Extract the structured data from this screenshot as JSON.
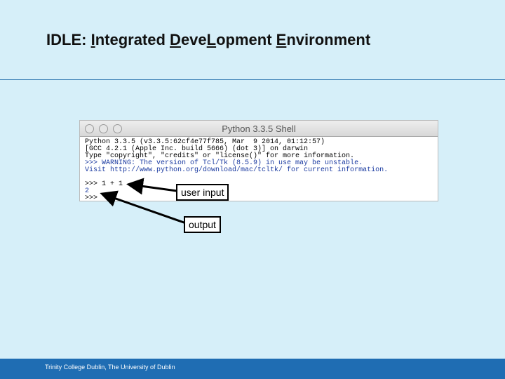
{
  "slide": {
    "title_parts": [
      "IDLE: ",
      "I",
      "ntegrated ",
      "D",
      "eve",
      "L",
      "opment ",
      "E",
      "nvironment"
    ],
    "footer": "Trinity College Dublin, The University of Dublin"
  },
  "shell": {
    "window_title": "Python 3.3.5 Shell",
    "lines": [
      "Python 3.3.5 (v3.3.5:62cf4e77f785, Mar  9 2014, 01:12:57)",
      "[GCC 4.2.1 (Apple Inc. build 5666) (dot 3)] on darwin",
      "Type \"copyright\", \"credits\" or \"license()\" for more information.",
      ">>> WARNING: The version of Tcl/Tk (8.5.9) in use may be unstable.",
      "Visit http://www.python.org/download/mac/tcltk/ for current information.",
      "",
      ">>> 1 + 1",
      "2",
      ">>> "
    ]
  },
  "annotations": {
    "user_input": "user input",
    "output": "output"
  }
}
